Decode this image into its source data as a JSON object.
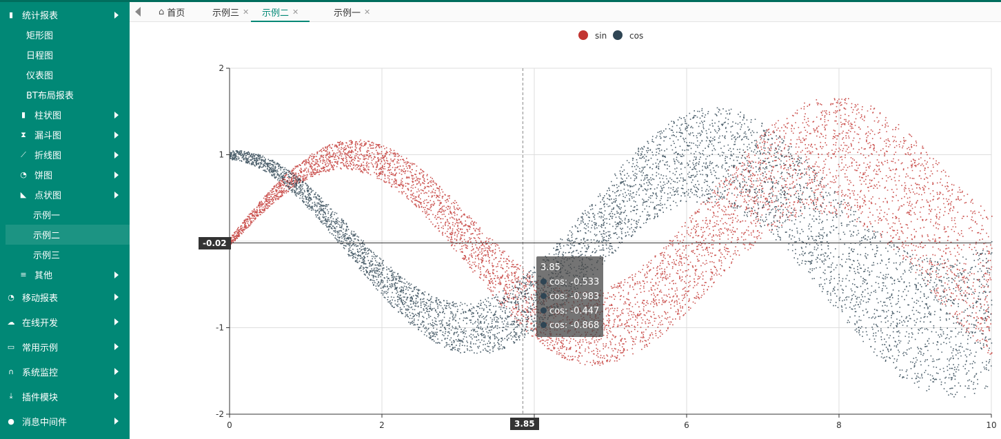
{
  "sidebar": {
    "items": [
      {
        "label": "统计报表",
        "icon": "bar-chart-icon",
        "arrow": true,
        "level": 0
      },
      {
        "label": "矩形图",
        "level": 1
      },
      {
        "label": "日程图",
        "level": 1
      },
      {
        "label": "仪表图",
        "level": 1
      },
      {
        "label": "BT布局报表",
        "level": 1
      },
      {
        "label": "柱状图",
        "icon": "bar-chart-icon",
        "arrow": true,
        "level": 2
      },
      {
        "label": "漏斗图",
        "icon": "hourglass-icon",
        "arrow": true,
        "level": 2
      },
      {
        "label": "折线图",
        "icon": "line-chart-icon",
        "arrow": true,
        "level": 2
      },
      {
        "label": "饼图",
        "icon": "pie-chart-icon",
        "arrow": true,
        "level": 2
      },
      {
        "label": "点状图",
        "icon": "area-chart-icon",
        "arrow": true,
        "level": 2
      },
      {
        "label": "示例一",
        "level": 3
      },
      {
        "label": "示例二",
        "level": 3,
        "active": true
      },
      {
        "label": "示例三",
        "level": 3
      },
      {
        "label": "其他",
        "icon": "list-icon",
        "arrow": true,
        "level": 2
      },
      {
        "label": "移动报表",
        "icon": "pie-chart-icon",
        "arrow": true,
        "level": 0
      },
      {
        "label": "在线开发",
        "icon": "cloud-icon",
        "arrow": true,
        "level": 0
      },
      {
        "label": "常用示例",
        "icon": "chat-icon",
        "arrow": true,
        "level": 0
      },
      {
        "label": "系统监控",
        "icon": "headset-icon",
        "arrow": true,
        "level": 0
      },
      {
        "label": "插件模块",
        "icon": "download-icon",
        "arrow": true,
        "level": 0
      },
      {
        "label": "消息中间件",
        "icon": "comment-icon",
        "arrow": true,
        "level": 0
      }
    ]
  },
  "tabs": [
    {
      "label": "首页",
      "icon": "home-icon",
      "closable": false
    },
    {
      "label": "示例三",
      "closable": true
    },
    {
      "label": "示例二",
      "closable": true,
      "active": true
    },
    {
      "label": "示例一",
      "closable": true
    }
  ],
  "colors": {
    "sin": "#c23531",
    "cos": "#2f4554",
    "brand": "#018876"
  },
  "tooltip": {
    "title": "3.85",
    "rows": [
      "cos: -0.533",
      "cos: -0.983",
      "cos: -0.447",
      "cos: -0.868"
    ]
  },
  "crosshair": {
    "x_label": "3.85",
    "y_label": "-0.02"
  },
  "chart_data": {
    "type": "scatter",
    "title": "",
    "xlabel": "",
    "ylabel": "",
    "xlim": [
      0,
      10
    ],
    "ylim": [
      -2,
      2
    ],
    "x_ticks": [
      0,
      2,
      4,
      6,
      8,
      10
    ],
    "y_ticks": [
      -2,
      -1,
      1,
      2
    ],
    "grid": true,
    "legend_position": "top-center",
    "series": [
      {
        "name": "sin",
        "color": "#c23531",
        "formula": "y = sin(x) + noise; noise grows with x (up to ~±0.85 at x=10)",
        "point_count": 6000
      },
      {
        "name": "cos",
        "color": "#2f4554",
        "formula": "y = cos(x) + noise; noise grows with x (up to ~±0.75 at x=10)",
        "point_count": 6000
      }
    ]
  }
}
